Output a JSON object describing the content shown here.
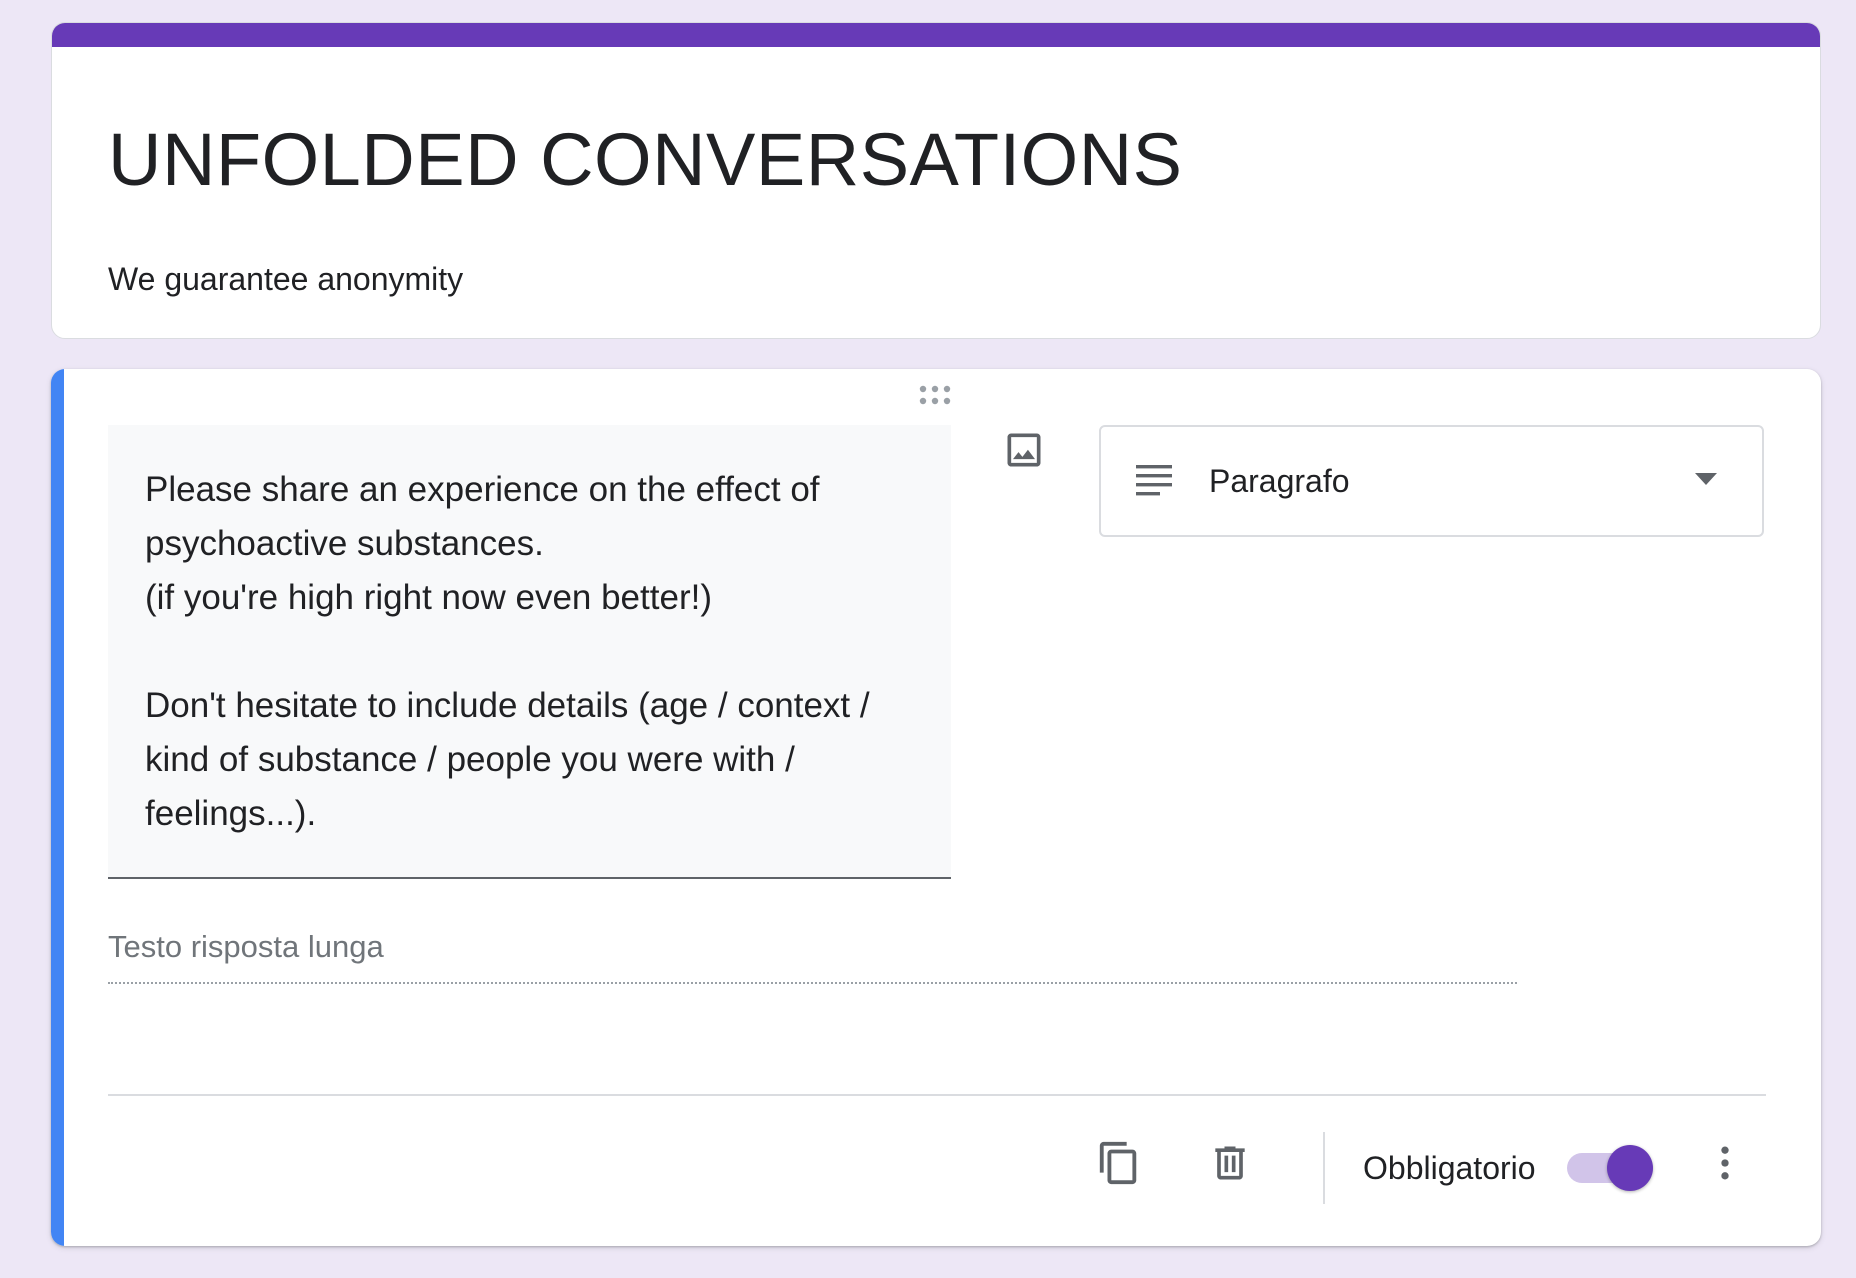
{
  "header": {
    "title": "UNFOLDED CONVERSATIONS",
    "description": "We guarantee anonymity",
    "accent_color": "#673ab7"
  },
  "question": {
    "text": "Please share an experience on the effect of\npsychoactive substances.\n(if you're high right now even better!)\n\nDon't hesitate to include details (age / context /\nkind of substance / people you were with /\nfeelings...).",
    "type_label": "Paragrafo",
    "type_icon": "paragraph-icon",
    "answer_placeholder": "Testo risposta lunga",
    "active_bar_color": "#4285f4"
  },
  "footer": {
    "required_label": "Obbligatorio",
    "required_on": true,
    "icons": [
      "copy-icon",
      "trash-icon",
      "more-vertical-icon"
    ]
  },
  "icons": {
    "drag": "drag-handle-icon",
    "image": "image-icon",
    "dropdown": "dropdown-caret-icon"
  }
}
